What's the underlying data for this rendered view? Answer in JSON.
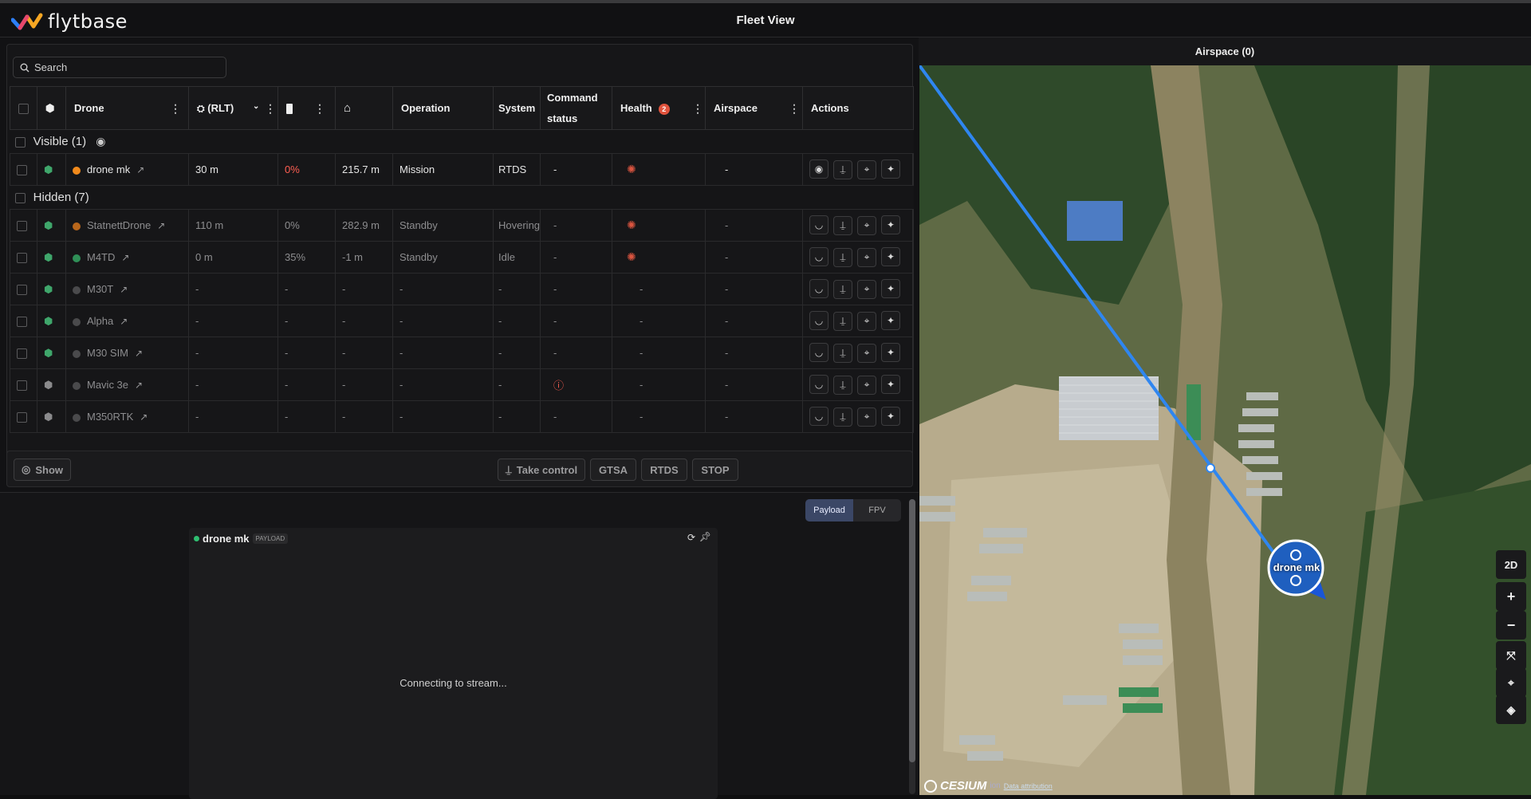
{
  "app": {
    "brand": "flytbase",
    "title": "Fleet View"
  },
  "search": {
    "placeholder": "Search"
  },
  "columns": {
    "drone": "Drone",
    "rlt": "(RLT)",
    "operation": "Operation",
    "system": "System",
    "command_l1": "Command",
    "command_l2": "status",
    "health": "Health",
    "health_badge": "2",
    "airspace": "Airspace",
    "actions": "Actions"
  },
  "groups": {
    "visible": "Visible (1)",
    "hidden": "Hidden (7)"
  },
  "visible_rows": [
    {
      "name": "drone mk",
      "status_color": "#f18a1c",
      "altitude": "30 m",
      "battery": "0%",
      "home": "215.7 m",
      "operation": "Mission",
      "system": "RTDS",
      "command": "-",
      "health": "alert",
      "airspace": "-"
    }
  ],
  "hidden_rows": [
    {
      "name": "StatnettDrone",
      "status_color": "#b8661b",
      "altitude": "110 m",
      "battery": "0%",
      "home": "282.9 m",
      "operation": "Standby",
      "system": "Hovering",
      "command": "-",
      "health": "alert",
      "airspace": "-"
    },
    {
      "name": "M4TD",
      "status_color": "#2f8f57",
      "altitude": "0 m",
      "battery": "35%",
      "home": "-1 m",
      "operation": "Standby",
      "system": "Idle",
      "command": "-",
      "health": "alert",
      "airspace": "-"
    },
    {
      "name": "M30T",
      "status_color": "#4a4a4c",
      "altitude": "-",
      "battery": "-",
      "home": "-",
      "operation": "-",
      "system": "-",
      "command": "-",
      "health": "-",
      "airspace": "-"
    },
    {
      "name": "Alpha",
      "status_color": "#4a4a4c",
      "altitude": "-",
      "battery": "-",
      "home": "-",
      "operation": "-",
      "system": "-",
      "command": "-",
      "health": "-",
      "airspace": "-"
    },
    {
      "name": "M30 SIM",
      "status_color": "#4a4a4c",
      "altitude": "-",
      "battery": "-",
      "home": "-",
      "operation": "-",
      "system": "-",
      "command": "-",
      "health": "-",
      "airspace": "-"
    },
    {
      "name": "Mavic 3e",
      "status_color": "#4a4a4c",
      "altitude": "-",
      "battery": "-",
      "home": "-",
      "operation": "-",
      "system": "-",
      "command": "warning",
      "health": "-",
      "airspace": "-"
    },
    {
      "name": "M350RTK",
      "status_color": "#4a4a4c",
      "altitude": "-",
      "battery": "-",
      "home": "-",
      "operation": "-",
      "system": "-",
      "command": "-",
      "health": "-",
      "airspace": "-"
    }
  ],
  "bottom_bar": {
    "show": "Show",
    "take_control": "Take control",
    "gtsa": "GTSA",
    "rtds": "RTDS",
    "stop": "STOP"
  },
  "video": {
    "tab_payload": "Payload",
    "tab_fpv": "FPV",
    "drone": "drone mk",
    "tag": "PAYLOAD",
    "status": "Connecting to stream..."
  },
  "map": {
    "header": "Airspace (0)",
    "drone_label": "drone mk",
    "mode": "2D",
    "zoom_in": "+",
    "zoom_out": "−",
    "cesium": "CESIUM",
    "cesium_ion": "ion",
    "attribution": "Data attribution"
  }
}
